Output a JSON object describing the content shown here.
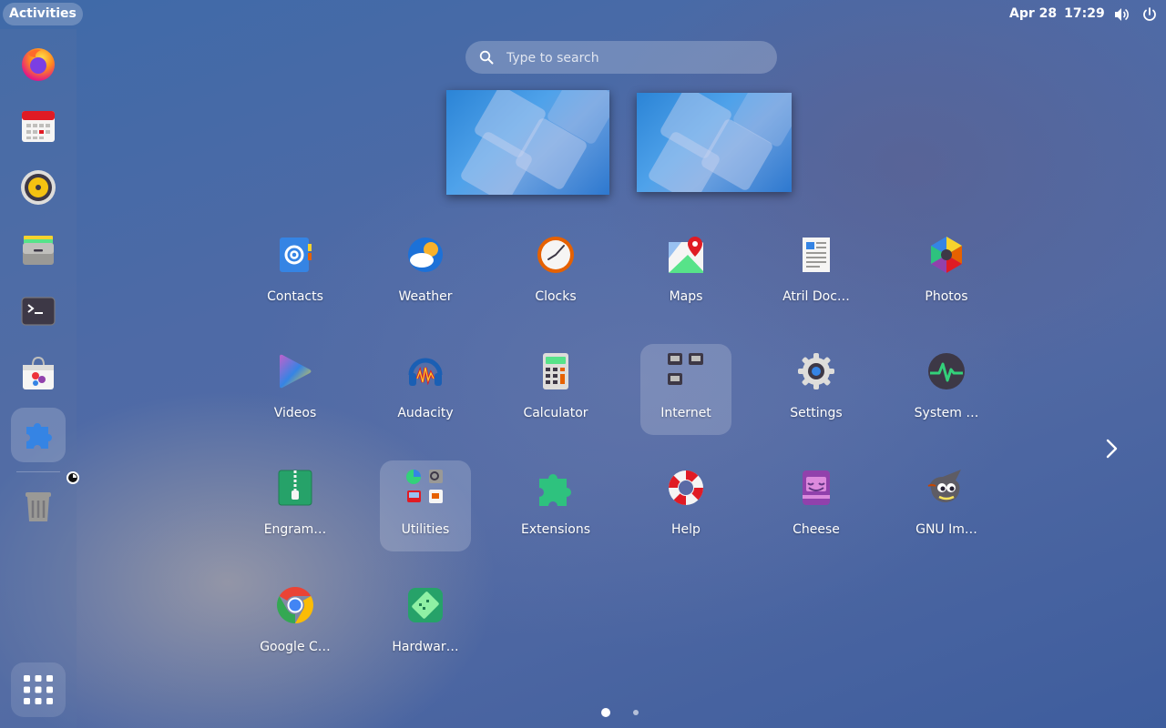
{
  "topbar": {
    "activities": "Activities",
    "date": "Apr 28",
    "time": "17:29",
    "icons": [
      "volume-icon",
      "power-icon"
    ]
  },
  "dock": {
    "items": [
      {
        "name": "firefox",
        "icon": "firefox-icon"
      },
      {
        "name": "calendar",
        "icon": "calendar-icon"
      },
      {
        "name": "rhythmbox",
        "icon": "speaker-icon"
      },
      {
        "name": "files",
        "icon": "file-cabinet-icon"
      },
      {
        "name": "terminal",
        "icon": "terminal-icon"
      },
      {
        "name": "software",
        "icon": "software-bag-icon"
      },
      {
        "name": "extensions",
        "icon": "puzzle-icon",
        "active": true
      },
      {
        "name": "trash",
        "icon": "trash-icon"
      },
      {
        "name": "show-apps",
        "icon": "app-grid-icon"
      }
    ]
  },
  "search": {
    "placeholder": "Type to search"
  },
  "apps": [
    {
      "label": "Contacts",
      "icon": "contacts-icon"
    },
    {
      "label": "Weather",
      "icon": "weather-icon"
    },
    {
      "label": "Clocks",
      "icon": "clock-icon"
    },
    {
      "label": "Maps",
      "icon": "maps-icon"
    },
    {
      "label": "Atril Doc…",
      "icon": "document-viewer-icon"
    },
    {
      "label": "Photos",
      "icon": "photos-icon"
    },
    {
      "label": "Videos",
      "icon": "videos-icon"
    },
    {
      "label": "Audacity",
      "icon": "audacity-icon"
    },
    {
      "label": "Calculator",
      "icon": "calculator-icon"
    },
    {
      "label": "Internet",
      "icon": "folder-internet-icon",
      "folder": true
    },
    {
      "label": "Settings",
      "icon": "settings-gear-icon"
    },
    {
      "label": "System …",
      "icon": "system-monitor-icon"
    },
    {
      "label": "Engram…",
      "icon": "archive-icon"
    },
    {
      "label": "Utilities",
      "icon": "folder-utilities-icon",
      "folder": true
    },
    {
      "label": "Extensions",
      "icon": "puzzle-icon"
    },
    {
      "label": "Help",
      "icon": "lifebuoy-icon"
    },
    {
      "label": "Cheese",
      "icon": "cheese-icon"
    },
    {
      "label": "GNU Im…",
      "icon": "gimp-icon"
    },
    {
      "label": "Google C…",
      "icon": "chrome-icon"
    },
    {
      "label": "Hardwar…",
      "icon": "hardware-icon"
    }
  ],
  "pager": {
    "pages": 2,
    "current": 1
  },
  "colors": {
    "accent": "#3584e4",
    "firefox": "#ff7139",
    "chrome_red": "#ea4335"
  }
}
